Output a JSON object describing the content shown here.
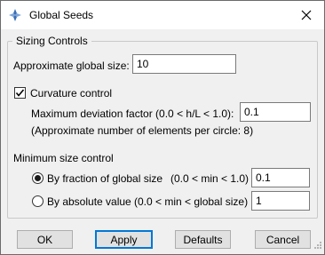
{
  "window": {
    "title": "Global Seeds",
    "icon": "abaqus-icon",
    "close_icon": "close-icon"
  },
  "group": {
    "label": "Sizing Controls",
    "global_size": {
      "label": "Approximate global size:",
      "value": "10"
    },
    "curvature": {
      "label": "Curvature control",
      "checked": true,
      "deviation_label": "Maximum deviation factor (0.0 < h/L < 1.0):",
      "deviation_value": "0.1",
      "approx_note": "(Approximate number of elements per circle: 8)"
    },
    "min_size": {
      "label": "Minimum size control",
      "by_fraction": {
        "label": "By fraction of global size",
        "range": "(0.0 < min < 1.0)",
        "value": "0.1",
        "selected": true
      },
      "by_absolute": {
        "label": "By absolute value",
        "range": "(0.0 < min < global size)",
        "value": "1",
        "selected": false
      }
    }
  },
  "buttons": {
    "ok": "OK",
    "apply": "Apply",
    "defaults": "Defaults",
    "cancel": "Cancel"
  }
}
